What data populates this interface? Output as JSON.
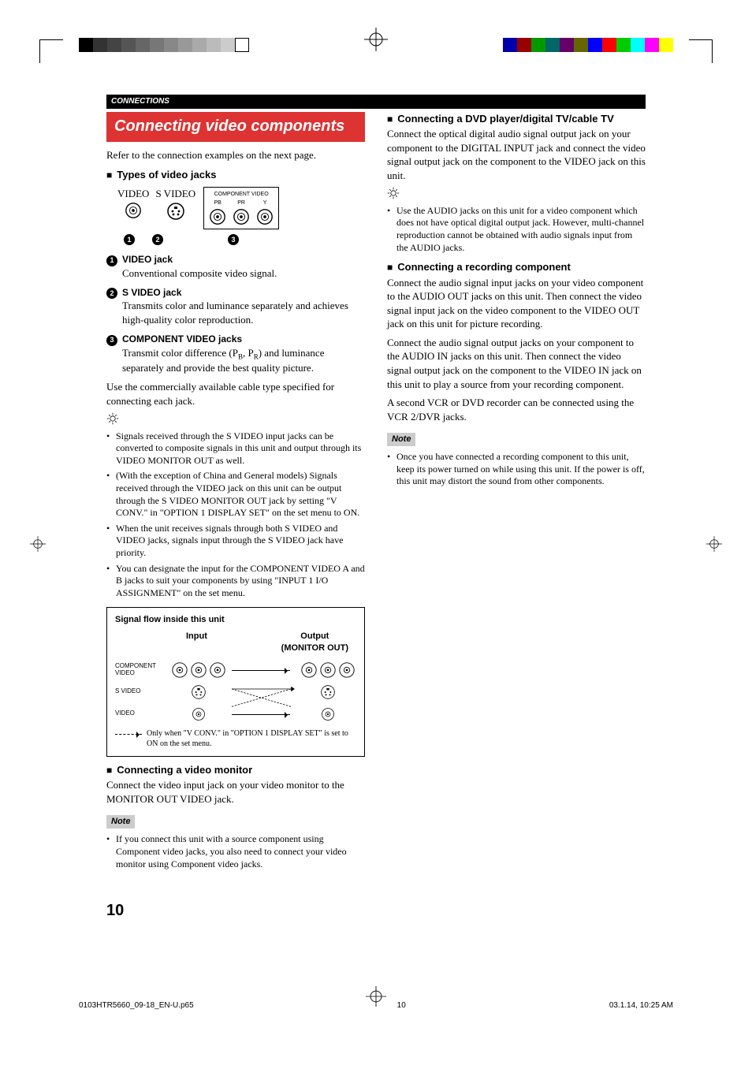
{
  "header": {
    "section": "CONNECTIONS"
  },
  "left": {
    "banner": "Connecting video components",
    "intro": "Refer to the connection examples on the next page.",
    "h_types": "Types of video jacks",
    "jack_labels": {
      "video": "VIDEO",
      "svideo": "S VIDEO",
      "component": "COMPONENT VIDEO",
      "pb": "PB",
      "pr": "PR",
      "y": "Y"
    },
    "item1": {
      "num": "1",
      "title": "VIDEO jack",
      "body": "Conventional composite video signal."
    },
    "item2": {
      "num": "2",
      "title": "S VIDEO jack",
      "body": "Transmits color and luminance separately and achieves high-quality color reproduction."
    },
    "item3": {
      "num": "3",
      "title": "COMPONENT VIDEO jacks",
      "body_pre": "Transmit color difference (P",
      "body_mid": ", P",
      "body_post": ") and luminance separately and provide the best quality picture.",
      "sub_b": "B",
      "sub_r": "R"
    },
    "cable_note": "Use the commercially available cable type specified for connecting each jack.",
    "bullets_a": [
      "Signals received through the S VIDEO input jacks can be converted to composite signals in this unit and output through its VIDEO MONITOR OUT as well.",
      "(With the exception of China and General models) Signals received through the VIDEO jack on this unit can be output through the S VIDEO MONITOR OUT jack by setting \"V CONV.\" in \"OPTION 1 DISPLAY SET\" on the set menu to ON.",
      "When the unit receives signals through both S VIDEO and VIDEO jacks, signals input through the S VIDEO jack have priority.",
      "You can designate the input for the COMPONENT VIDEO A and B jacks to suit your components by using \"INPUT 1 I/O ASSIGNMENT\" on the set menu."
    ],
    "flow": {
      "title": "Signal flow inside this unit",
      "input": "Input",
      "output_l1": "Output",
      "output_l2": "(MONITOR OUT)",
      "rows": {
        "component": "COMPONENT VIDEO",
        "svideo": "S VIDEO",
        "video": "VIDEO"
      },
      "legend": "Only when \"V CONV.\" in \"OPTION 1 DISPLAY SET\" is set to ON on the set menu."
    },
    "h_monitor": "Connecting a video monitor",
    "monitor_body": "Connect the video input jack on your video monitor to the MONITOR OUT VIDEO jack.",
    "note_label": "Note",
    "note_monitor": "If you connect this unit with a source component using Component video jacks, you also need to connect your video monitor using Component video jacks."
  },
  "right": {
    "h_dvd": "Connecting a DVD player/digital TV/cable TV",
    "dvd_body": "Connect the optical digital audio signal output jack on your component to the DIGITAL INPUT jack and connect the video signal output jack on the component to the VIDEO jack on this unit.",
    "dvd_tip": "Use the AUDIO jacks on this unit for a video component which does not have optical digital output jack. However, multi-channel reproduction cannot be obtained with audio signals input from the AUDIO jacks.",
    "h_rec": "Connecting a recording component",
    "rec_p1": "Connect the audio signal input jacks on your video component to the AUDIO OUT jacks on this unit. Then connect the video signal input jack on the video component to the VIDEO OUT jack on this unit for picture recording.",
    "rec_p2": "Connect the audio signal output jacks on your component to the AUDIO IN jacks on this unit. Then connect the video signal output jack on the component to the VIDEO IN jack on this unit to play a source from your recording component.",
    "rec_p3": "A second VCR or DVD recorder can be connected using the VCR 2/DVR jacks.",
    "note_label": "Note",
    "note_rec": "Once you have connected a recording component to this unit, keep its power turned on while using this unit. If the power is off, this unit may distort the sound from other components."
  },
  "page_number": "10",
  "footer": {
    "file": "0103HTR5660_09-18_EN-U.p65",
    "page": "10",
    "date": "03.1.14, 10:25 AM"
  }
}
